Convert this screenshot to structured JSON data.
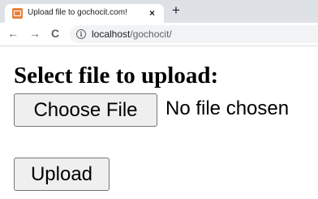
{
  "browser": {
    "tab": {
      "favicon": "xampp-icon",
      "title": "Upload file to gochocit.com!",
      "close_glyph": "×"
    },
    "new_tab_glyph": "+",
    "nav": {
      "back_glyph": "←",
      "forward_glyph": "→",
      "reload_glyph": "C"
    },
    "address_bar": {
      "info_glyph": "i",
      "url_host": "localhost",
      "url_path": "/gochocit/"
    }
  },
  "page": {
    "heading": "Select file to upload:",
    "file_input": {
      "button_label": "Choose File",
      "status_text": "No file chosen"
    },
    "submit_label": "Upload"
  },
  "colors": {
    "tabstrip_bg": "#dee1e6",
    "favicon": "#e8823a",
    "button_bg": "#efefef"
  }
}
